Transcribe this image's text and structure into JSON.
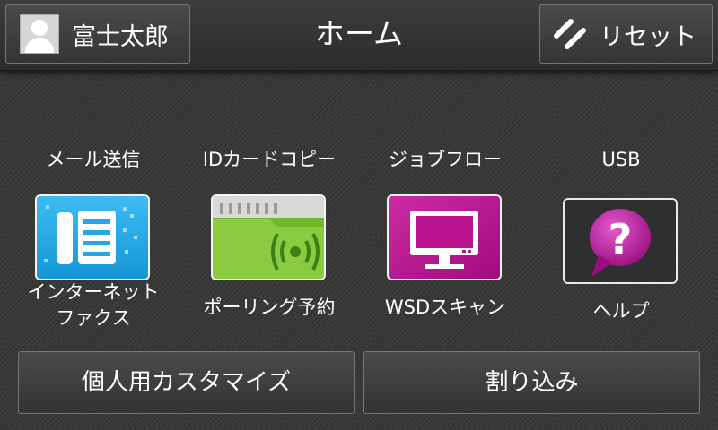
{
  "header": {
    "user_name": "富士太郎",
    "title": "ホーム",
    "reset_label": "リセット"
  },
  "tiles": [
    {
      "label": "メール送信",
      "icon": "mail-icon"
    },
    {
      "label": "IDカードコピー",
      "icon": "id-card-icon"
    },
    {
      "label": "ジョブフロー",
      "icon": "job-flow-icon"
    },
    {
      "label": "USB",
      "icon": "usb-icon"
    },
    {
      "label_line1": "インターネット",
      "label_line2": "ファクス",
      "icon": "internet-fax-icon"
    },
    {
      "label": "ポーリング予約",
      "icon": "polling-icon"
    },
    {
      "label": "WSDスキャン",
      "icon": "monitor-icon"
    },
    {
      "label": "ヘルプ",
      "icon": "help-icon"
    }
  ],
  "bottom": {
    "customize_label": "個人用カスタマイズ",
    "interrupt_label": "割り込み"
  },
  "colors": {
    "mail": "#f6a21c",
    "id_card": "#c0168e",
    "job_flow": "#b81aa0",
    "usb": "#f29a1a",
    "internet_fax": "#23a9e8",
    "polling": "#7fc03a",
    "wsd_scan": "#b8128f",
    "help": "#b81a9a"
  }
}
